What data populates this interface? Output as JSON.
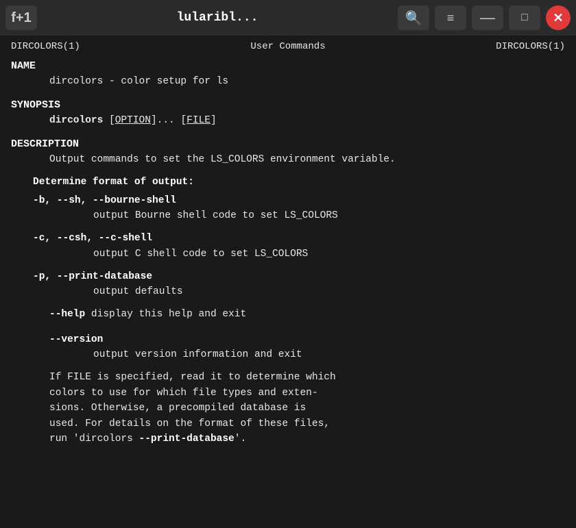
{
  "titlebar": {
    "new_tab_label": "f+1",
    "title": "lularibl...",
    "search_icon": "🔍",
    "menu_icon": "≡",
    "minimize_icon": "—",
    "maximize_icon": "□",
    "close_icon": "✕"
  },
  "man_header": {
    "left": "DIRCOLORS(1)",
    "center": "User Commands",
    "right": "DIRCOLORS(1)"
  },
  "sections": {
    "name": {
      "title": "NAME",
      "content": "dircolors - color setup for ls"
    },
    "synopsis": {
      "title": "SYNOPSIS",
      "cmd": "dircolors",
      "options": "[OPTION]... [FILE]"
    },
    "description": {
      "title": "DESCRIPTION",
      "intro": "Output  commands to set the LS_COLORS environment variable.",
      "determine_format": "Determine format of output:",
      "options": [
        {
          "flag": "-b, --sh, --bourne-shell",
          "desc": "output Bourne shell code to set LS_COLORS"
        },
        {
          "flag": "-c, --csh, --c-shell",
          "desc": "output C shell code to set LS_COLORS"
        },
        {
          "flag": "-p, --print-database",
          "desc": "output defaults"
        }
      ],
      "help_flag": "--help",
      "help_desc": "display this help and exit",
      "version_flag": "--version",
      "version_desc": "output version information and exit",
      "paragraph": "If FILE is specified, read it to determine  which colors  to  use  for  which file types and exten-sions.   Otherwise,  a  precompiled  database  is used.   For details on the format of these files, run 'dircolors --print-database'."
    }
  }
}
